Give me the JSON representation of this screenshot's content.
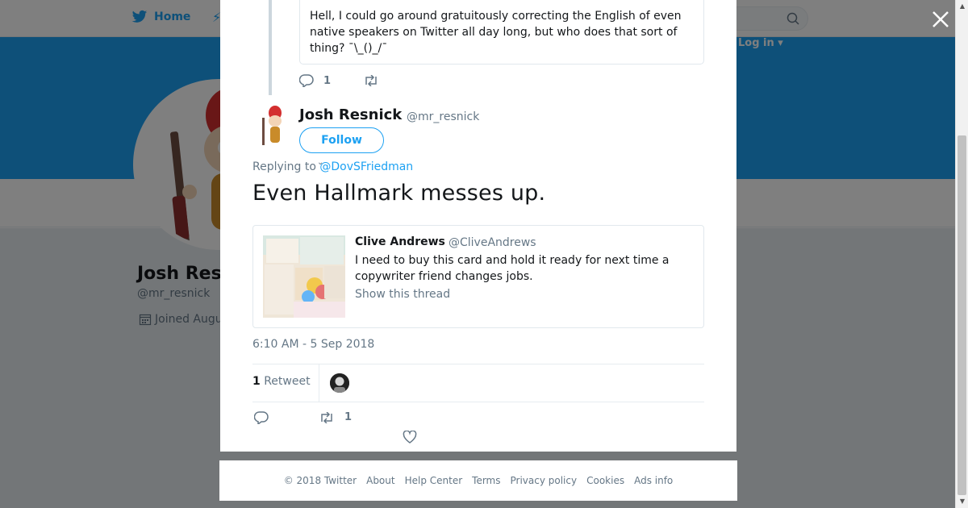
{
  "topnav": {
    "home_label": "Home",
    "login_label": "Log in ▾"
  },
  "profile_bg": {
    "name": "Josh Resnick",
    "handle": "@mr_resnick",
    "joined": "Joined August"
  },
  "prev_tweet": {
    "text": "Hell, I could go around gratuitously correcting the English of even native speakers on Twitter all day long, but who does that sort of thing? ¯\\_()_/¯",
    "reply_count": "1"
  },
  "tweet": {
    "author_name": "Josh Resnick",
    "author_handle": "@mr_resnick",
    "follow_label": "Follow",
    "replying_prefix": "Replying to",
    "replying_to": "@DovSFriedman",
    "text": "Even Hallmark messes up.",
    "timestamp": "6:10 AM - 5 Sep 2018",
    "retweet_count": "1",
    "retweet_label": "Retweet",
    "action_retweet_count": "1"
  },
  "quoted_tweet": {
    "author_name": "Clive Andrews",
    "author_handle": "@CliveAndrews",
    "text": "I need to buy this card and hold it ready for next time a copywriter friend changes jobs.",
    "show_thread": "Show this thread"
  },
  "footer": {
    "links": [
      "© 2018 Twitter",
      "About",
      "Help Center",
      "Terms",
      "Privacy policy",
      "Cookies",
      "Ads info"
    ]
  },
  "icons": {
    "close": "close-icon",
    "reply": "reply-icon",
    "retweet": "retweet-icon",
    "like": "heart-icon",
    "twitter": "twitter-bird-icon",
    "search": "search-icon",
    "calendar": "calendar-icon"
  },
  "colors": {
    "accent": "#1da1f2",
    "banner": "#1da1f2",
    "muted": "#657786"
  }
}
